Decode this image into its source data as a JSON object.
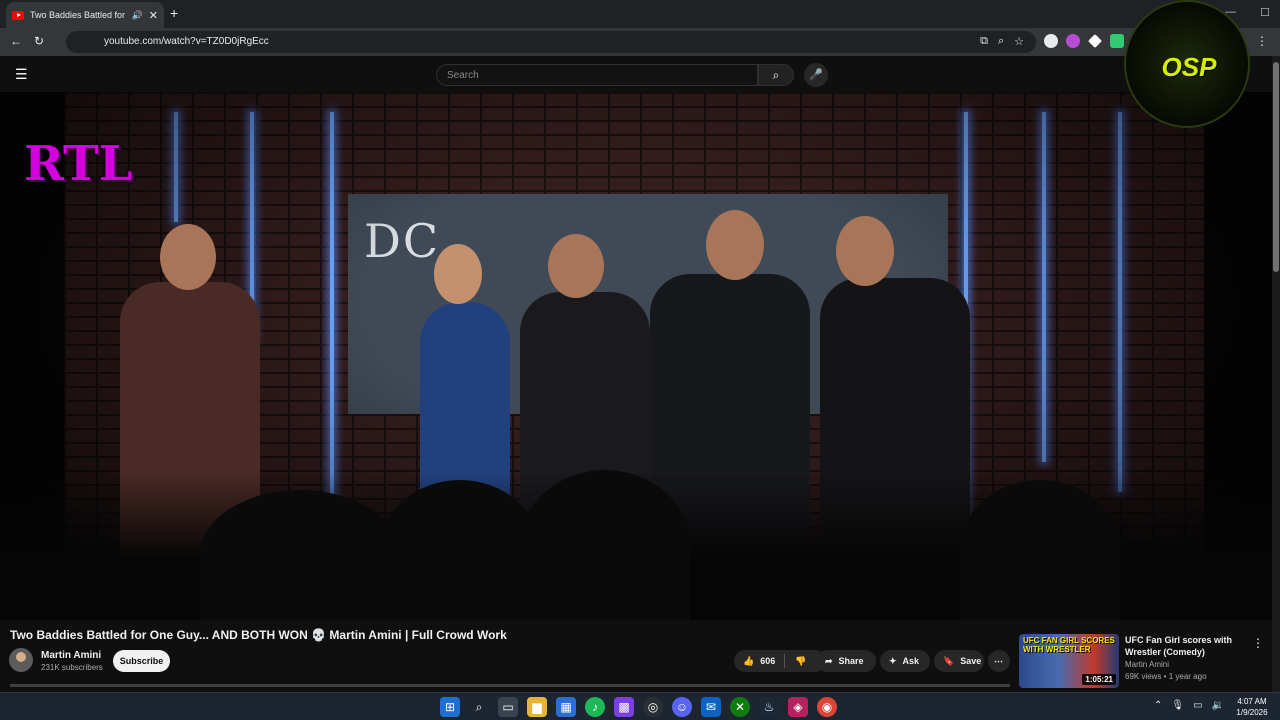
{
  "browser": {
    "tab_title": "Two Baddies Battled for One Guy... AND BOTH WON",
    "tab_audio_icon": "speaker-icon",
    "url": "youtube.com/watch?v=TZ0D0jRgEcc"
  },
  "masthead": {
    "search_placeholder": "Search"
  },
  "video_overlay": {
    "left_logo": "RTL",
    "right_logo": "OSP"
  },
  "sign_text": "DC",
  "video": {
    "title": "Two Baddies Battled for One Guy... AND BOTH WON 💀 Martin Amini | Full Crowd Work",
    "channel_name": "Martin Amini",
    "subscribers": "231K subscribers",
    "subscribe_label": "Subscribe",
    "like_count": "606",
    "share_label": "Share",
    "ask_label": "Ask",
    "save_label": "Save"
  },
  "recommendation": {
    "title": "UFC Fan Girl scores with Wrestler (Comedy)",
    "channel": "Martin Amini",
    "meta": "69K views • 1 year ago",
    "duration": "1:05:21",
    "thumb_text": "UFC FAN GIRL SCORES WITH WRESTLER"
  },
  "taskbar": {
    "time": "4:07 AM",
    "date": "1/9/2026"
  },
  "colors": {
    "background": "#0f0f0f",
    "subscribe_bg": "#f1f1f1",
    "neon": "#6fa8ff",
    "overlay_purple": "#d400e0",
    "overlay_yellow": "#d7f000"
  }
}
